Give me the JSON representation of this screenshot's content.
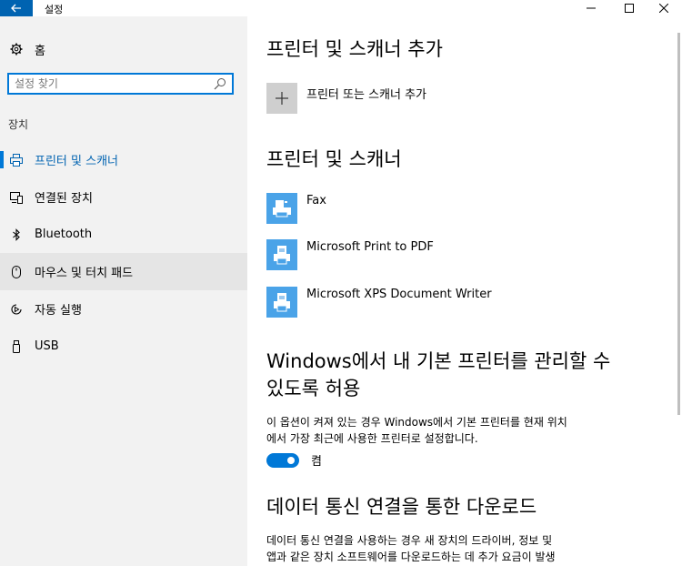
{
  "window": {
    "title": "설정"
  },
  "sidebar": {
    "home_label": "홈",
    "search_placeholder": "설정 찾기",
    "section_label": "장치",
    "items": [
      {
        "label": "프린터 및 스캐너",
        "icon": "printer-icon",
        "selected": true
      },
      {
        "label": "연결된 장치",
        "icon": "connected-devices-icon"
      },
      {
        "label": "Bluetooth",
        "icon": "bluetooth-icon"
      },
      {
        "label": "마우스 및 터치 패드",
        "icon": "mouse-icon",
        "hover": true
      },
      {
        "label": "자동 실행",
        "icon": "autoplay-icon"
      },
      {
        "label": "USB",
        "icon": "usb-icon"
      }
    ]
  },
  "main": {
    "add_heading": "프린터 및 스캐너 추가",
    "add_label": "프린터 또는 스캐너 추가",
    "printers_heading": "프린터 및 스캐너",
    "printers": [
      {
        "name": "Fax",
        "icon": "fax-icon"
      },
      {
        "name": "Microsoft Print to PDF",
        "icon": "printer-icon"
      },
      {
        "name": "Microsoft XPS Document Writer",
        "icon": "printer-icon"
      }
    ],
    "default_heading_line1": "Windows에서 내 기본 프린터를 관리할 수",
    "default_heading_line2": "있도록 허용",
    "default_desc_line1": "이 옵션이 켜져 있는 경우 Windows에서 기본 프린터를 현재 위치",
    "default_desc_line2": "에서 가장 최근에 사용한 프린터로 설정합니다.",
    "toggle_state": "켬",
    "download_heading": "데이터 통신 연결을 통한 다운로드",
    "download_desc_line1": "데이터 통신 연결을 사용하는 경우 새 장치의 드라이버, 정보 및",
    "download_desc_line2": "앱과 같은 장치 소프트웨어를 다운로드하는 데 추가 요금이 발생"
  },
  "colors": {
    "accent": "#0078d7",
    "title_back": "#0063b1",
    "sidebar_bg": "#f2f2f2",
    "tile_blue": "#4aa3e8"
  }
}
